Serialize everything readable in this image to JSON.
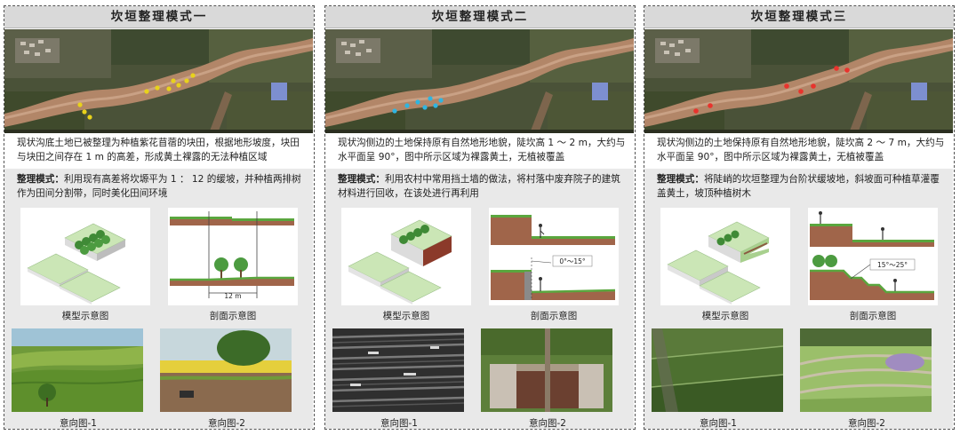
{
  "panels": [
    {
      "title": "坎垣整理模式一",
      "intro": "现状沟底土地已被整理为种植紫花苜蓿的块田，根据地形坡度，块田与块田之间存在 1 m 的高差，形成黄土裸露的无法种植区域",
      "mode_label": "整理模式：",
      "mode_text": "利用现有高差将坎塬平为 1 ： 12 的缓坡，并种植两排树作为田间分割带，同时美化田间环境",
      "model_caption": "模型示意图",
      "section_caption": "剖面示意图",
      "section_dim": "12 m",
      "section_angle": "",
      "photo1_caption": "意向图-1",
      "photo2_caption": "意向图-2",
      "marker_color": "#e8d21b"
    },
    {
      "title": "坎垣整理模式二",
      "intro": "现状沟侧边的土地保持原有自然地形地貌，陡坎高 1 ～ 2 m，大约与水平面呈 90°，图中所示区域为裸露黄土，无植被覆盖",
      "mode_label": "整理模式：",
      "mode_text": "利用农村中常用挡土墙的做法，将村落中废弃院子的建筑材料进行回收，在该处进行再利用",
      "model_caption": "模型示意图",
      "section_caption": "剖面示意图",
      "section_dim": "",
      "section_angle": "0°～15°",
      "photo1_caption": "意向图-1",
      "photo2_caption": "意向图-2",
      "marker_color": "#2fb5e0"
    },
    {
      "title": "坎垣整理模式三",
      "intro": "现状沟侧边的土地保持原有自然地形地貌，陡坎高 2 ～ 7 m，大约与水平面呈 90°，图中所示区域为裸露黄土，无植被覆盖",
      "mode_label": "整理模式：",
      "mode_text": "将陡峭的坎垣整理为台阶状缓坡地，斜坡面可种植草灌覆盖黄土，坡顶种植树木",
      "model_caption": "模型示意图",
      "section_caption": "剖面示意图",
      "section_dim": "",
      "section_angle": "15°～25°",
      "photo1_caption": "意向图-1",
      "photo2_caption": "意向图-2",
      "marker_color": "#e8332d"
    }
  ]
}
